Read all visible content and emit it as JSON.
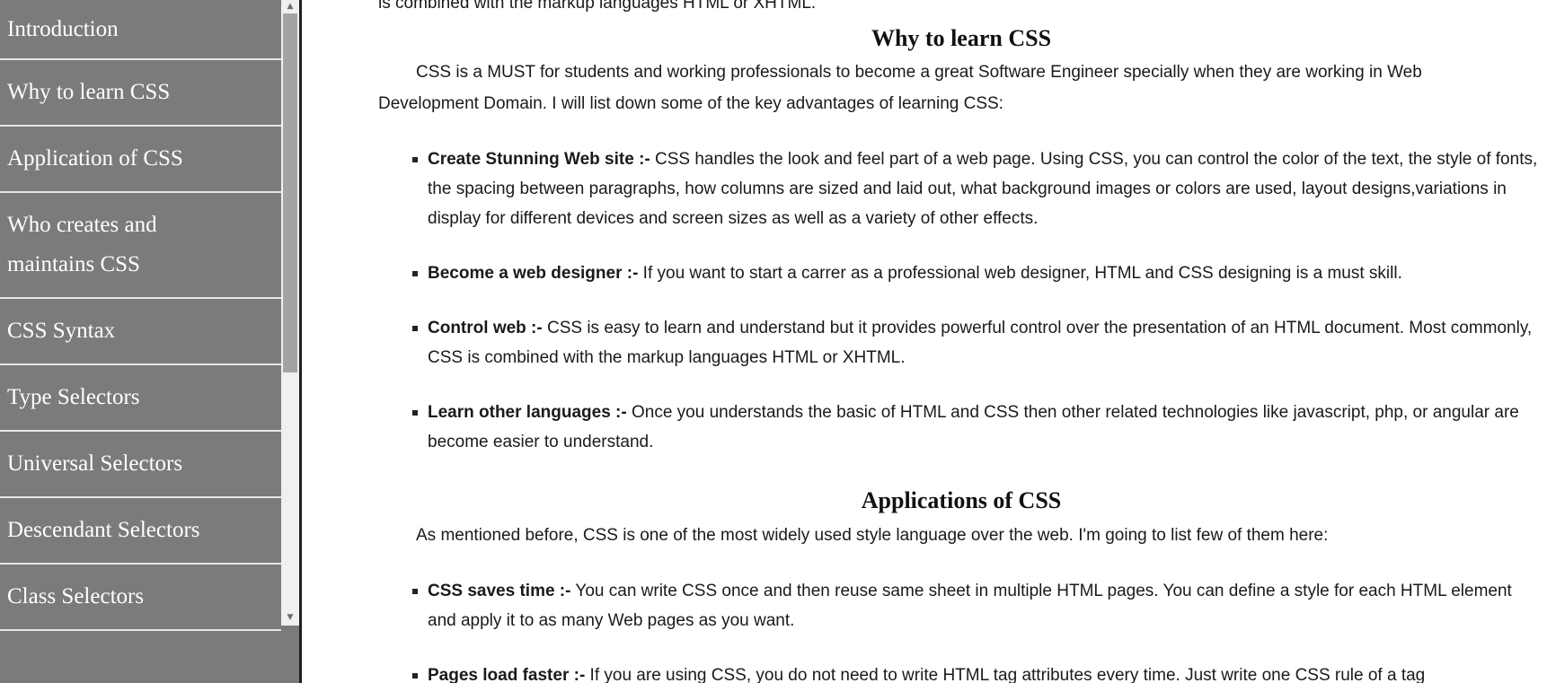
{
  "sidebar": {
    "items": [
      {
        "label": "Introduction"
      },
      {
        "label": "Why to learn CSS"
      },
      {
        "label": "Application of CSS"
      },
      {
        "label": "Who creates and maintains CSS"
      },
      {
        "label": "CSS Syntax"
      },
      {
        "label": "Type Selectors"
      },
      {
        "label": "Universal Selectors"
      },
      {
        "label": "Descendant Selectors"
      },
      {
        "label": "Class Selectors"
      }
    ],
    "scroll_up_glyph": "▲",
    "scroll_down_glyph": "▼"
  },
  "content": {
    "top_fragment": "is combined with the markup languages HTML or XHTML.",
    "why_heading": "Why to learn CSS",
    "why_paragraph_1": "CSS is a MUST for students and working professionals to become a great Software Engineer specially when they are working in Web",
    "why_paragraph_2": "Development Domain. I will list down some of the key advantages of learning CSS:",
    "why_items": [
      {
        "term": "Create Stunning Web site :-",
        "text": " CSS handles the look and feel part of a web page. Using CSS, you can control the color of the text, the style of fonts, the spacing between paragraphs, how columns are sized and laid out, what background images or colors are used, layout designs,variations in display for different devices and screen sizes as well as a variety of other effects."
      },
      {
        "term": "Become a web designer :-",
        "text": " If you want to start a carrer as a professional web designer, HTML and CSS designing is a must skill."
      },
      {
        "term": "Control web :-",
        "text": " CSS is easy to learn and understand but it provides powerful control over the presentation of an HTML document. Most commonly, CSS is combined with the markup languages HTML or XHTML."
      },
      {
        "term": "Learn other languages :-",
        "text": " Once you understands the basic of HTML and CSS then other related technologies like javascript, php, or angular are become easier to understand."
      }
    ],
    "apps_heading": "Applications of CSS",
    "apps_intro": "As mentioned before, CSS is one of the most widely used style language over the web. I'm going to list few of them here:",
    "apps_items": [
      {
        "term": "CSS saves time :-",
        "text": " You can write CSS once and then reuse same sheet in multiple HTML pages. You can define a style for each HTML element and apply it to as many Web pages as you want."
      },
      {
        "term": "Pages load faster :-",
        "text": " If you are using CSS, you do not need to write HTML tag attributes every time. Just write one CSS rule of a tag"
      }
    ]
  }
}
